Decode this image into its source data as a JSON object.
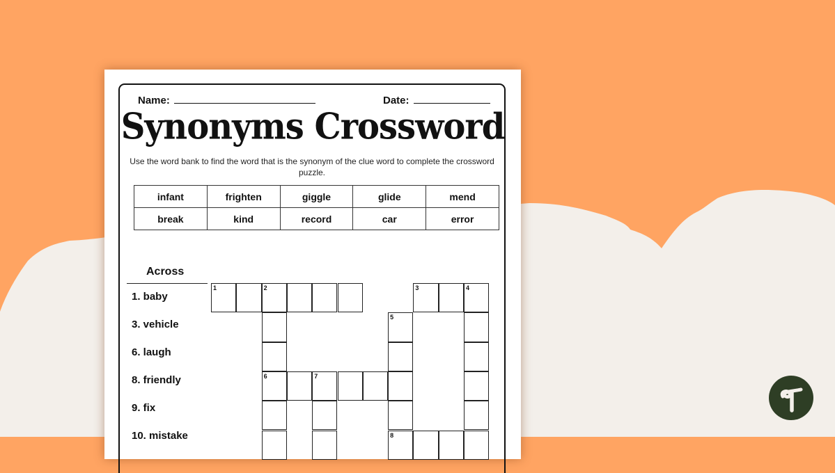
{
  "colors": {
    "background_orange": "#FFA462",
    "background_cream": "#F3EFEA",
    "logo_green": "#2E3E25"
  },
  "worksheet": {
    "name_label": "Name:",
    "date_label": "Date:",
    "title": "Synonyms Crossword",
    "instructions": "Use the word bank to find the word that is the synonym  of the clue word to complete the crossword puzzle.",
    "word_bank": [
      [
        "infant",
        "frighten",
        "giggle",
        "glide",
        "mend"
      ],
      [
        "break",
        "kind",
        "record",
        "car",
        "error"
      ]
    ],
    "across": {
      "heading": "Across",
      "clues": [
        "1. baby",
        "3. vehicle",
        "6. laugh",
        "8. friendly",
        "9. fix",
        "10. mistake"
      ]
    },
    "grid": {
      "cells": [
        {
          "r": 0,
          "c": 0,
          "n": "1"
        },
        {
          "r": 0,
          "c": 1
        },
        {
          "r": 0,
          "c": 2,
          "n": "2"
        },
        {
          "r": 0,
          "c": 3
        },
        {
          "r": 0,
          "c": 4
        },
        {
          "r": 0,
          "c": 5
        },
        {
          "r": 0,
          "c": 8,
          "n": "3"
        },
        {
          "r": 0,
          "c": 9
        },
        {
          "r": 0,
          "c": 10,
          "n": "4"
        },
        {
          "r": 1,
          "c": 2
        },
        {
          "r": 1,
          "c": 7,
          "n": "5"
        },
        {
          "r": 1,
          "c": 10
        },
        {
          "r": 2,
          "c": 2
        },
        {
          "r": 2,
          "c": 7
        },
        {
          "r": 2,
          "c": 10
        },
        {
          "r": 3,
          "c": 2,
          "n": "6"
        },
        {
          "r": 3,
          "c": 3
        },
        {
          "r": 3,
          "c": 4,
          "n": "7"
        },
        {
          "r": 3,
          "c": 5
        },
        {
          "r": 3,
          "c": 6
        },
        {
          "r": 3,
          "c": 7
        },
        {
          "r": 3,
          "c": 10
        },
        {
          "r": 4,
          "c": 2
        },
        {
          "r": 4,
          "c": 4
        },
        {
          "r": 4,
          "c": 7
        },
        {
          "r": 4,
          "c": 10
        },
        {
          "r": 5,
          "c": 2
        },
        {
          "r": 5,
          "c": 4
        },
        {
          "r": 5,
          "c": 7,
          "n": "8"
        },
        {
          "r": 5,
          "c": 8
        },
        {
          "r": 5,
          "c": 9
        },
        {
          "r": 5,
          "c": 10
        }
      ]
    }
  },
  "brand": {
    "logo_icon": "teach-starter-logo-icon"
  }
}
